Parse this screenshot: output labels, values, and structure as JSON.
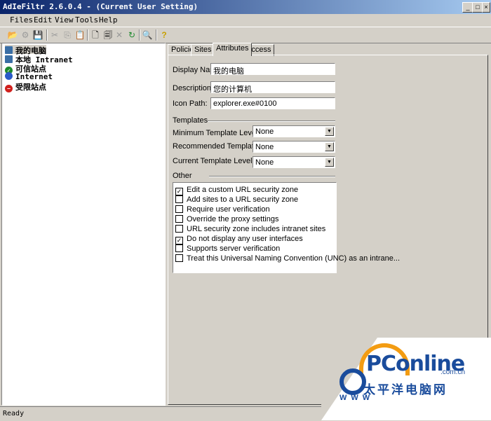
{
  "window": {
    "title": "AdIeFiltr 2.6.0.4 - (Current User Setting)",
    "buttons": [
      "_",
      "□",
      "×"
    ]
  },
  "menu": [
    "Files",
    "Edit",
    "View",
    "Tools",
    "Help"
  ],
  "toolbar": {
    "icons": [
      "open-folder",
      "disabled-gear",
      "save",
      "cut",
      "copy",
      "paste",
      "delete",
      "new-document",
      "paste-document",
      "refresh",
      "find",
      "help"
    ],
    "glyphs": [
      "📂",
      "⚙",
      "💾",
      "✂",
      "⎘",
      "📋",
      "✕",
      "🗋",
      "🗐",
      "↻",
      "🔍",
      "?"
    ]
  },
  "tree": {
    "items": [
      {
        "label": "我的电脑",
        "icon": "my-computer",
        "selected": true,
        "color": "#3a6ea5"
      },
      {
        "label": "本地 Intranet",
        "icon": "intranet",
        "selected": false,
        "color": "#3a6ea5"
      },
      {
        "label": "可信站点",
        "icon": "trusted-sites",
        "selected": false,
        "color": "#1e8a2e"
      },
      {
        "label": "Internet",
        "icon": "internet-globe",
        "selected": false,
        "color": "#2a5ac8"
      },
      {
        "label": "受限站点",
        "icon": "restricted-sites",
        "selected": false,
        "color": "#d0201c"
      }
    ]
  },
  "tabs": [
    "Policies",
    "Sites",
    "Attributes",
    "Access"
  ],
  "active_tab": "Attributes",
  "attributes": {
    "display_name_label": "Display Name:",
    "display_name_value": "我的电脑",
    "description_label": "Description:",
    "description_value": "您的计算机",
    "icon_path_label": "Icon Path:",
    "icon_path_value": "explorer.exe#0100",
    "templates_heading": "Templates",
    "min_template_label": "Minimum Template Level:",
    "min_template_value": "None",
    "rec_template_label": "Recommended Template Level:",
    "rec_template_value": "None",
    "cur_template_label": "Current Template Level:",
    "cur_template_value": "None",
    "other_heading": "Other",
    "options": [
      {
        "label": "Edit a custom URL security zone",
        "checked": true
      },
      {
        "label": "Add sites to a URL security zone",
        "checked": false
      },
      {
        "label": "Require user verification",
        "checked": false
      },
      {
        "label": "Override the proxy settings",
        "checked": false
      },
      {
        "label": "URL security zone includes intranet sites",
        "checked": false
      },
      {
        "label": "Do not display any user interfaces",
        "checked": true
      },
      {
        "label": "Supports server verification",
        "checked": false
      },
      {
        "label": "Treat this Universal Naming Convention (UNC) as an intrane...",
        "checked": false
      }
    ]
  },
  "status": "Ready",
  "watermark": {
    "logo": "PConline",
    "domain": ".com.cn",
    "cn": "太平洋电脑网",
    "www": "WWW"
  }
}
